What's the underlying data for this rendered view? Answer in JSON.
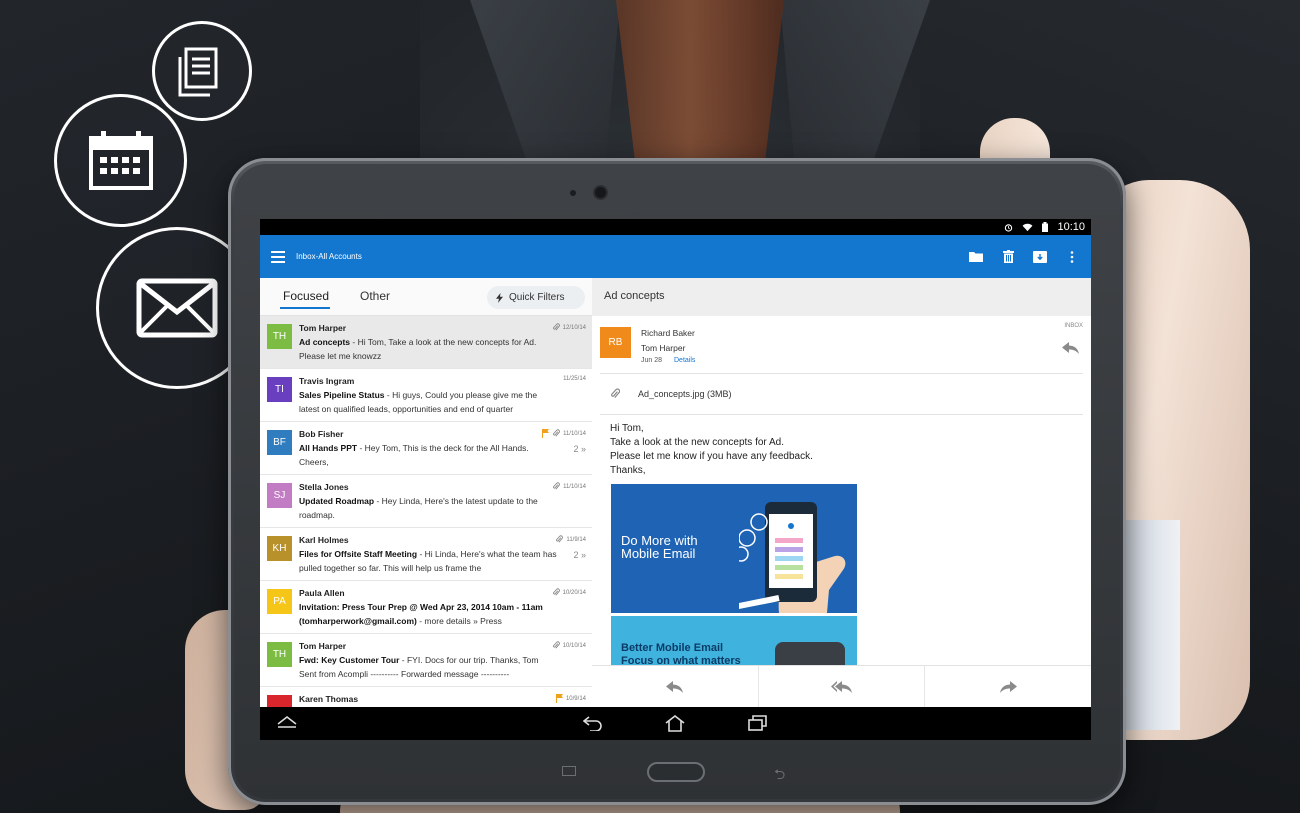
{
  "status_bar": {
    "time": "10:10"
  },
  "app_bar": {
    "title": "Inbox-All Accounts",
    "accent": "#1376cf"
  },
  "tabs": {
    "focused": "Focused",
    "other": "Other",
    "quick_filters": "Quick Filters"
  },
  "messages": [
    {
      "initials": "TH",
      "color": "#7cbc42",
      "sender": "Tom Harper",
      "subject": "Ad concepts",
      "snippet": " - Hi Tom, Take a look at the new concepts for Ad. Please let me knowzz",
      "date": "12/10/14",
      "attachment": true,
      "flag": false,
      "count": ""
    },
    {
      "initials": "TI",
      "color": "#6a3fbf",
      "sender": "Travis Ingram",
      "subject": "Sales Pipeline Status",
      "snippet": " - Hi guys, Could you please give me the latest on qualified leads, opportunities and end of quarter",
      "date": "11/25/14",
      "attachment": false,
      "flag": false,
      "count": ""
    },
    {
      "initials": "BF",
      "color": "#2f7dbf",
      "sender": "Bob Fisher",
      "subject": "All Hands PPT",
      "snippet": " - Hey Tom, This is the deck for the All Hands. Cheers,",
      "date": "11/10/14",
      "attachment": true,
      "flag": true,
      "count": "2"
    },
    {
      "initials": "SJ",
      "color": "#c27cc4",
      "sender": "Stella Jones",
      "subject": "Updated Roadmap",
      "snippet": " - Hey Linda, Here's the latest update to the roadmap.",
      "date": "11/10/14",
      "attachment": true,
      "flag": false,
      "count": ""
    },
    {
      "initials": "KH",
      "color": "#b8912a",
      "sender": "Karl Holmes",
      "subject": "Files for Offsite Staff Meeting",
      "snippet": " - Hi Linda, Here's what the team has pulled together so far. This will help us frame the",
      "date": "11/9/14",
      "attachment": true,
      "flag": false,
      "count": "2"
    },
    {
      "initials": "PA",
      "color": "#f5c518",
      "sender": "Paula Allen",
      "subject": "Invitation: Press Tour Prep @ Wed Apr 23, 2014 10am - 11am (tomharperwork@gmail.com)",
      "snippet": " - more details » Press",
      "date": "10/20/14",
      "attachment": true,
      "flag": false,
      "count": ""
    },
    {
      "initials": "TH",
      "color": "#7cbc42",
      "sender": "Tom Harper",
      "subject": "Fwd: Key Customer Tour",
      "snippet": " - FYI. Docs for our trip. Thanks, Tom Sent from Acompli ---------- Forwarded message ----------",
      "date": "10/10/14",
      "attachment": true,
      "flag": false,
      "count": ""
    },
    {
      "initials": "",
      "color": "#d9262c",
      "sender": "Karen Thomas",
      "subject": "",
      "snippet": "",
      "date": "10/9/14",
      "attachment": false,
      "flag": true,
      "count": ""
    }
  ],
  "reading": {
    "subject": "Ad concepts",
    "avatar_initials": "RB",
    "avatar_color": "#f08a1b",
    "from": "Richard Baker",
    "to": "Tom Harper",
    "date": "Jun 28",
    "details": "Details",
    "folder_tag": "INBOX",
    "attachment": "Ad_concepts.jpg (3MB)",
    "body_lines": [
      "Hi Tom,",
      "Take a look at the new concepts for Ad.",
      "Please let me know if you have any feedback.",
      "Thanks,"
    ],
    "promo1_line1": "Do More with",
    "promo1_line2": "Mobile Email",
    "promo2_line1": "Better Mobile Email",
    "promo2_line2": "Focus on what matters"
  }
}
